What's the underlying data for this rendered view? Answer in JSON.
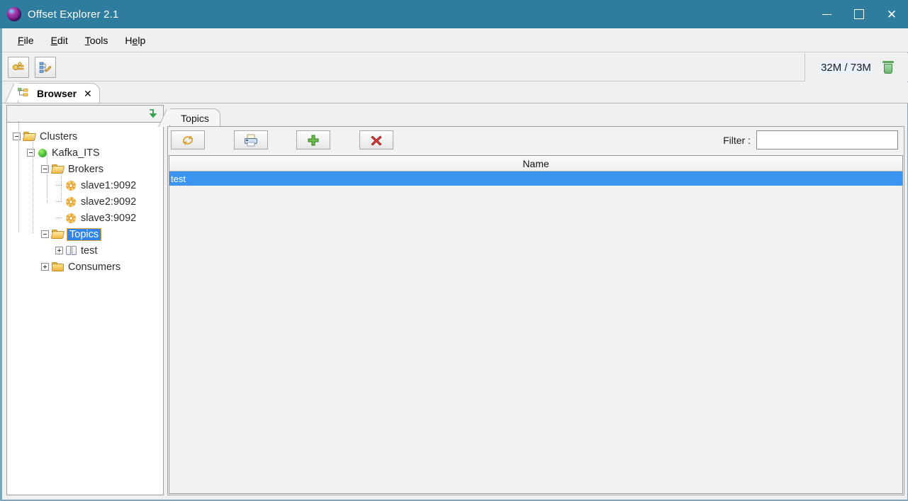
{
  "window": {
    "title": "Offset Explorer  2.1",
    "icon": "app-sphere-icon",
    "controls": {
      "minimize": "–",
      "maximize": "□",
      "close": "✕"
    }
  },
  "menubar": {
    "items": [
      {
        "label": "File",
        "mnemonic": "F"
      },
      {
        "label": "Edit",
        "mnemonic": "E"
      },
      {
        "label": "Tools",
        "mnemonic": "T"
      },
      {
        "label": "Help",
        "mnemonic": "H"
      }
    ]
  },
  "toolbar": {
    "buttons": [
      {
        "name": "add-cluster-button",
        "icon": "connector-plug-icon"
      },
      {
        "name": "edit-cluster-button",
        "icon": "tree-edit-pencil-icon"
      }
    ],
    "memory": {
      "text": "32M / 73M",
      "trash_icon": "trash-can-icon"
    }
  },
  "tabstrip": {
    "tabs": [
      {
        "label": "Browser",
        "icon": "tree-hierarchy-icon",
        "close": "✕",
        "active": true
      }
    ]
  },
  "tree_panel": {
    "header_icon": "collapse-all-green-arrow-icon",
    "nodes": [
      {
        "label": "Clusters",
        "icon": "folder-open-icon",
        "expander": "minus",
        "depth": 0,
        "selected": false
      },
      {
        "label": "Kafka_ITS",
        "icon": "green-status-dot-icon",
        "expander": "minus",
        "depth": 1,
        "selected": false
      },
      {
        "label": "Brokers",
        "icon": "folder-open-icon",
        "expander": "minus",
        "depth": 2,
        "selected": false
      },
      {
        "label": "slave1:9092",
        "icon": "broker-gear-icon",
        "expander": "none",
        "depth": 3,
        "selected": false
      },
      {
        "label": "slave2:9092",
        "icon": "broker-gear-icon",
        "expander": "none",
        "depth": 3,
        "selected": false
      },
      {
        "label": "slave3:9092",
        "icon": "broker-gear-icon",
        "expander": "none",
        "depth": 3,
        "selected": false
      },
      {
        "label": "Topics",
        "icon": "folder-open-icon",
        "expander": "minus",
        "depth": 2,
        "selected": true
      },
      {
        "label": "test",
        "icon": "topic-book-icon",
        "expander": "plus",
        "depth": 3,
        "selected": false
      },
      {
        "label": "Consumers",
        "icon": "folder-closed-icon",
        "expander": "plus",
        "depth": 2,
        "selected": false
      }
    ]
  },
  "content": {
    "tab_label": "Topics",
    "toolbar_buttons": [
      {
        "name": "refresh-button",
        "icon": "refresh-arrows-icon"
      },
      {
        "name": "print-button",
        "icon": "printer-icon"
      },
      {
        "name": "add-topic-button",
        "icon": "green-plus-icon"
      },
      {
        "name": "delete-topic-button",
        "icon": "red-x-icon"
      }
    ],
    "filter": {
      "label": "Filter :",
      "value": "",
      "placeholder": ""
    },
    "table": {
      "columns": [
        "Name"
      ],
      "rows": [
        {
          "name": "test",
          "selected": true
        }
      ]
    }
  },
  "colors": {
    "titlebar": "#2f7d9e",
    "selection_blue": "#3b94f0",
    "tree_selection_blue": "#2f86e8",
    "panel_gray": "#f2f2f2",
    "accent_orange": "#e8a33d"
  }
}
